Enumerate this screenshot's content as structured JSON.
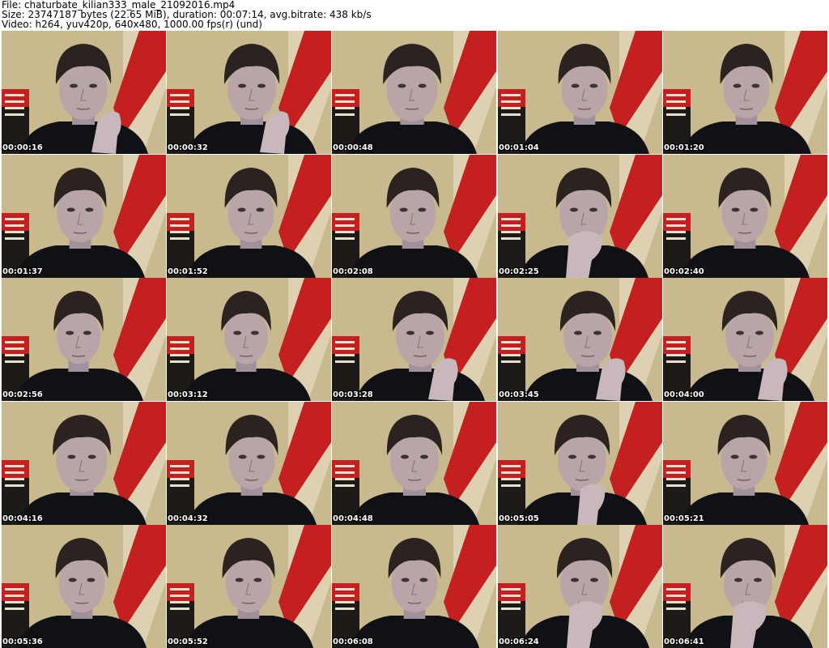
{
  "header": {
    "file_line": "File: chaturbate_kilian333_male_21092016.mp4",
    "size_line": "Size: 23747187 bytes (22.65 MiB), duration: 00:07:14, avg.bitrate: 438 kb/s",
    "video_line": "Video: h264, yuv420p, 640x480, 1000.00 fps(r) (und)"
  },
  "colors": {
    "wall": "#c9b98f",
    "wall_light": "#e6dcc0",
    "stripe": "#c3201f",
    "shirt": "#101114",
    "hair": "#2a2320",
    "skin": "#b9a5a8"
  },
  "thumbnails": [
    {
      "timestamp": "00:00:16",
      "pose": "hand"
    },
    {
      "timestamp": "00:00:32",
      "pose": "hand"
    },
    {
      "timestamp": "00:00:48",
      "pose": "neutral"
    },
    {
      "timestamp": "00:01:04",
      "pose": "neutral"
    },
    {
      "timestamp": "00:01:20",
      "pose": "neutral"
    },
    {
      "timestamp": "00:01:37",
      "pose": "neutral"
    },
    {
      "timestamp": "00:01:52",
      "pose": "neutral"
    },
    {
      "timestamp": "00:02:08",
      "pose": "neutral"
    },
    {
      "timestamp": "00:02:25",
      "pose": "mouth"
    },
    {
      "timestamp": "00:02:40",
      "pose": "neutral"
    },
    {
      "timestamp": "00:02:56",
      "pose": "neutral"
    },
    {
      "timestamp": "00:03:12",
      "pose": "neutral"
    },
    {
      "timestamp": "00:03:28",
      "pose": "hand"
    },
    {
      "timestamp": "00:03:45",
      "pose": "hand"
    },
    {
      "timestamp": "00:04:00",
      "pose": "hand"
    },
    {
      "timestamp": "00:04:16",
      "pose": "neutral"
    },
    {
      "timestamp": "00:04:32",
      "pose": "neutral"
    },
    {
      "timestamp": "00:04:48",
      "pose": "neutral"
    },
    {
      "timestamp": "00:05:05",
      "pose": "chin"
    },
    {
      "timestamp": "00:05:21",
      "pose": "neutral"
    },
    {
      "timestamp": "00:05:36",
      "pose": "neutral"
    },
    {
      "timestamp": "00:05:52",
      "pose": "neutral"
    },
    {
      "timestamp": "00:06:08",
      "pose": "neutral"
    },
    {
      "timestamp": "00:06:24",
      "pose": "mouth"
    },
    {
      "timestamp": "00:06:41",
      "pose": "mouth"
    }
  ]
}
